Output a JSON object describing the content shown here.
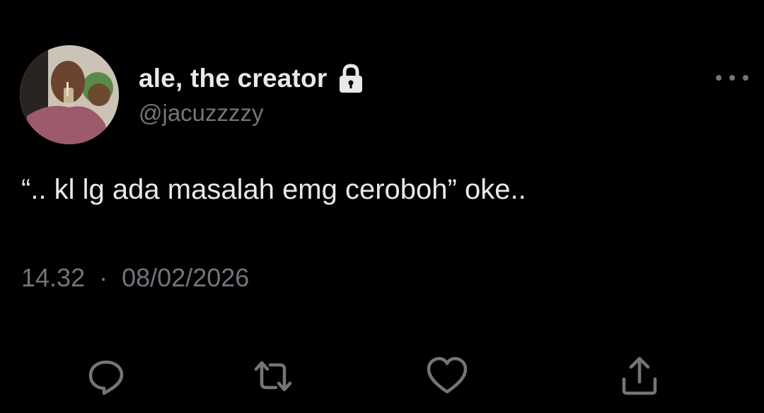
{
  "tweet": {
    "author": {
      "display_name": "ale, the creator",
      "handle": "@jacuzzzzy",
      "protected_icon": "lock-icon",
      "avatar_icon": "avatar-photo"
    },
    "text": "“.. kl lg ada masalah emg ceroboh” oke..",
    "time": "14.32",
    "separator": "·",
    "date": "08/02/2026",
    "more_icon": "more-horizontal-icon"
  },
  "actions": [
    {
      "name": "reply",
      "icon": "reply-icon"
    },
    {
      "name": "retweet",
      "icon": "retweet-icon"
    },
    {
      "name": "like",
      "icon": "heart-icon"
    },
    {
      "name": "share",
      "icon": "share-icon"
    }
  ],
  "colors": {
    "background": "#000000",
    "primary_text": "#e7e9ea",
    "secondary_text": "#71767b"
  }
}
